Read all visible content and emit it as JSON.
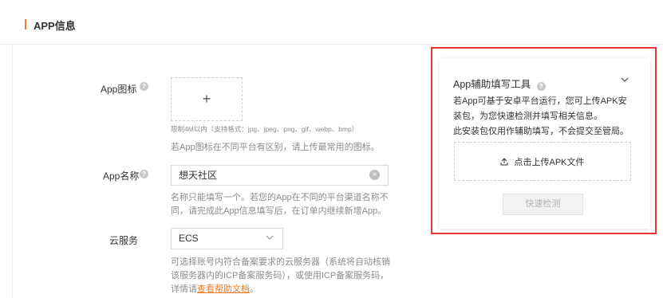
{
  "section": {
    "title": "APP信息"
  },
  "form": {
    "icon": {
      "label": "App图标",
      "upload_symbol": "+",
      "size_hint": "限制4M以内（支持格式：jpg、jpeg、png、gif、webp、bmp）",
      "note": "若App图标在不同平台有区别，请上传最常用的图标。"
    },
    "name": {
      "label": "App名称",
      "value": "想天社区",
      "note_line1": "名称只能填写一个。若您的App在不同的平台渠道名称不",
      "note_line2": "同，请完成此App信息填写后，在订单内继续新增App。"
    },
    "cloud": {
      "label": "云服务",
      "selected": "ECS",
      "note_line1": "可选择账号内符合备案要求的云服务器（系统将自动核销",
      "note_line2": "该服务器内的ICP备案服务码），或使用ICP备案服务码，",
      "note_line3_prefix": "详情请",
      "note_link": "查看帮助文档",
      "note_line3_suffix": "。"
    }
  },
  "helper_panel": {
    "title": "App辅助填写工具",
    "desc_line1": "若App可基于安卓平台运行，您可上传APK安",
    "desc_line2": "装包，为您快速检测并填写相关信息。",
    "desc_line3": "此安装包仅用作辅助填写，不会提交至管局。",
    "upload_label": "点击上传APK文件",
    "detect_button": "快速检测"
  },
  "colors": {
    "accent": "#f07c27",
    "highlight_frame": "#e53935"
  },
  "icons": {
    "help": "question-circle-icon",
    "clear": "close-circle-icon",
    "dropdown": "chevron-down-icon",
    "upload": "upload-icon",
    "collapse": "chevron-down-icon"
  }
}
